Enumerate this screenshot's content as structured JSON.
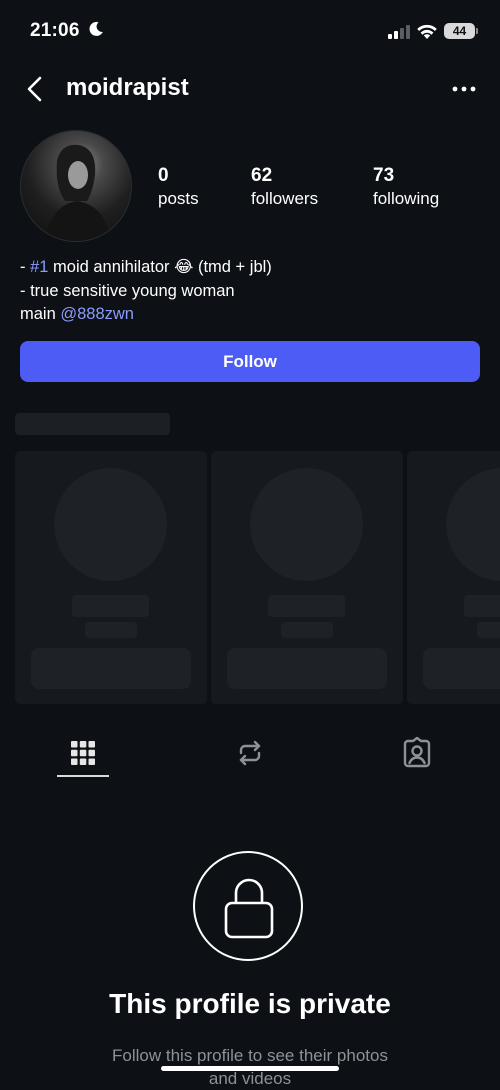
{
  "status_bar": {
    "time": "21:06",
    "battery": "44",
    "icons": [
      "moon-icon",
      "signal-icon",
      "wifi-icon",
      "battery-icon"
    ]
  },
  "header": {
    "username": "moidrapist",
    "icons": [
      "chevron-left-icon",
      "more-dots-icon"
    ]
  },
  "stats": {
    "posts": {
      "value": "0",
      "label": "posts"
    },
    "followers": {
      "value": "62",
      "label": "followers"
    },
    "following": {
      "value": "73",
      "label": "following"
    }
  },
  "bio": {
    "line1_prefix": "- ",
    "line1_tag": "#1",
    "line1_text": " moid annihilator ",
    "line1_emoji": "😂",
    "line1_suffix": " (tmd + jbl)",
    "line2": "- true sensitive young woman",
    "line3_prefix": "main ",
    "line3_link": "@888zwn"
  },
  "follow_button": {
    "label": "Follow"
  },
  "tabs": {
    "icons": [
      "grid-icon",
      "repost-icon",
      "tagged-icon"
    ],
    "active": "grid-icon"
  },
  "private_notice": {
    "title": "This profile is private",
    "subtitle_line1": "Follow this profile to see their photos",
    "subtitle_line2": "and videos"
  },
  "colors": {
    "background": "#0d1014",
    "accent": "#4d5cf5",
    "link": "#8c9bff"
  }
}
